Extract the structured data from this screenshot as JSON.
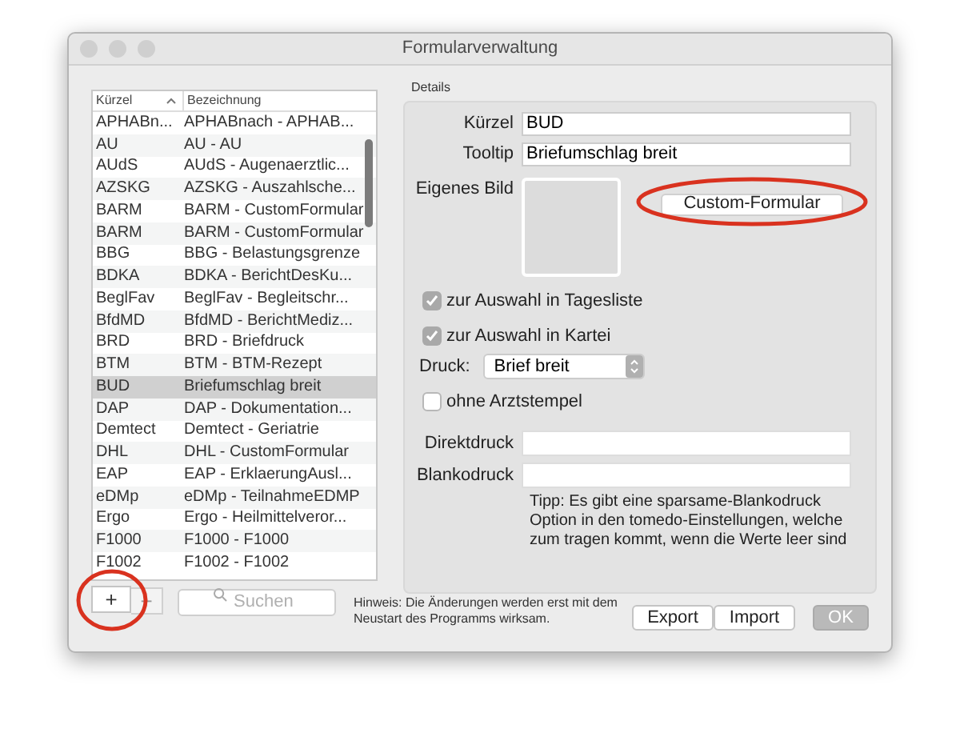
{
  "window": {
    "title": "Formularverwaltung"
  },
  "list": {
    "columns": [
      {
        "label": "Kürzel",
        "sorted": true
      },
      {
        "label": "Bezeichnung",
        "sorted": false
      }
    ],
    "rows": [
      {
        "kuerzel": "APHABn...",
        "bezeichnung": "APHABnach - APHAB...",
        "selected": false
      },
      {
        "kuerzel": "AU",
        "bezeichnung": "AU - AU",
        "selected": false
      },
      {
        "kuerzel": "AUdS",
        "bezeichnung": "AUdS - Augenaerztlic...",
        "selected": false
      },
      {
        "kuerzel": "AZSKG",
        "bezeichnung": "AZSKG - Auszahlsche...",
        "selected": false
      },
      {
        "kuerzel": "BARM",
        "bezeichnung": "BARM - CustomFormular",
        "selected": false
      },
      {
        "kuerzel": "BARM",
        "bezeichnung": "BARM - CustomFormular",
        "selected": false
      },
      {
        "kuerzel": "BBG",
        "bezeichnung": "BBG - Belastungsgrenze",
        "selected": false
      },
      {
        "kuerzel": "BDKA",
        "bezeichnung": "BDKA - BerichtDesKu...",
        "selected": false
      },
      {
        "kuerzel": "BeglFav",
        "bezeichnung": "BeglFav - Begleitschr...",
        "selected": false
      },
      {
        "kuerzel": "BfdMD",
        "bezeichnung": "BfdMD - BerichtMediz...",
        "selected": false
      },
      {
        "kuerzel": "BRD",
        "bezeichnung": "BRD - Briefdruck",
        "selected": false
      },
      {
        "kuerzel": "BTM",
        "bezeichnung": "BTM - BTM-Rezept",
        "selected": false
      },
      {
        "kuerzel": "BUD",
        "bezeichnung": "Briefumschlag breit",
        "selected": true
      },
      {
        "kuerzel": "DAP",
        "bezeichnung": "DAP - Dokumentation...",
        "selected": false
      },
      {
        "kuerzel": "Demtect",
        "bezeichnung": "Demtect - Geriatrie",
        "selected": false
      },
      {
        "kuerzel": "DHL",
        "bezeichnung": "DHL - CustomFormular",
        "selected": false
      },
      {
        "kuerzel": "EAP",
        "bezeichnung": "EAP - ErklaerungAusl...",
        "selected": false
      },
      {
        "kuerzel": "eDMp",
        "bezeichnung": "eDMp - TeilnahmeEDMP",
        "selected": false
      },
      {
        "kuerzel": "Ergo",
        "bezeichnung": "Ergo - Heilmittelveror...",
        "selected": false
      },
      {
        "kuerzel": "F1000",
        "bezeichnung": "F1000 - F1000",
        "selected": false
      },
      {
        "kuerzel": "F1002",
        "bezeichnung": "F1002 - F1002",
        "selected": false
      }
    ]
  },
  "list_controls": {
    "add": {
      "label": "+",
      "highlighted": true
    },
    "remove": {
      "label": "−"
    },
    "search": {
      "placeholder": "Suchen"
    }
  },
  "hint": "Hinweis: Die Änderungen werden erst mit dem Neustart des Programms wirksam.",
  "details": {
    "title": "Details",
    "kuerzel": {
      "label": "Kürzel",
      "value": "BUD"
    },
    "tooltip": {
      "label": "Tooltip",
      "value": "Briefumschlag breit"
    },
    "image": {
      "label": "Eigenes Bild"
    },
    "custom_button": {
      "label": "Custom-Formular",
      "highlighted": true
    },
    "checkboxes": [
      {
        "label": "zur Auswahl in Tagesliste",
        "checked": true
      },
      {
        "label": "zur Auswahl in Kartei",
        "checked": true
      }
    ],
    "druck": {
      "label": "Druck:",
      "value": "Brief breit"
    },
    "stamp_checkbox": {
      "label": "ohne Arztstempel",
      "checked": false
    },
    "direktdruck": {
      "label": "Direktdruck"
    },
    "blankodruck": {
      "label": "Blankodruck"
    },
    "tip": "Tipp: Es gibt eine sparsame-Blankodruck Option in den tomedo-Einstellungen, welche zum tragen kommt, wenn die  Werte leer sind"
  },
  "buttons": [
    {
      "label": "Export",
      "disabled": false
    },
    {
      "label": "Import",
      "disabled": false
    },
    {
      "label": "OK",
      "disabled": true
    }
  ]
}
